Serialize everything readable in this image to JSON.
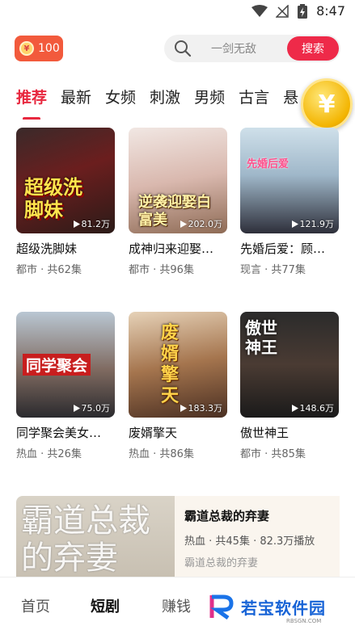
{
  "status_bar": {
    "time": "8:47"
  },
  "header": {
    "coin_count": "100",
    "coin_symbol": "¥",
    "search_placeholder": "一剑无敌",
    "search_button": "搜索"
  },
  "tabs": [
    "推荐",
    "最新",
    "女频",
    "刺激",
    "男频",
    "古言",
    "悬"
  ],
  "floating_coin_symbol": "¥",
  "dramas": [
    {
      "title": "超级洗脚妹",
      "meta": "都市 · 共62集",
      "plays": "81.2万",
      "poster_text": "超级洗脚妹"
    },
    {
      "title": "成神归来迎娶…",
      "meta": "都市 · 共96集",
      "plays": "202.0万",
      "poster_text": "逆袭迎娶白富美"
    },
    {
      "title": "先婚后爱：顾…",
      "meta": "现言 · 共77集",
      "plays": "121.9万",
      "poster_text": "先婚后爱"
    },
    {
      "title": "同学聚会美女…",
      "meta": "热血 · 共26集",
      "plays": "75.0万",
      "poster_text": "同学聚会"
    },
    {
      "title": "废婿擎天",
      "meta": "热血 · 共86集",
      "plays": "183.3万",
      "poster_text": "废婿擎天"
    },
    {
      "title": "傲世神王",
      "meta": "都市 · 共85集",
      "plays": "148.6万",
      "poster_text": "傲世神王"
    }
  ],
  "featured": {
    "title": "霸道总裁的弃妻",
    "meta": "热血 · 共45集 · 82.3万播放",
    "desc": "霸道总裁的弃妻",
    "poster_text": "霸道总裁的弃妻"
  },
  "bottom_nav": [
    "首页",
    "短剧",
    "赚钱"
  ],
  "watermark": {
    "text": "若宝软件园",
    "sub": "RBSGN.COM"
  },
  "colors": {
    "accent": "#e8283f",
    "search_button": "#ee2a49",
    "coin_badge": "#f25a3c"
  }
}
